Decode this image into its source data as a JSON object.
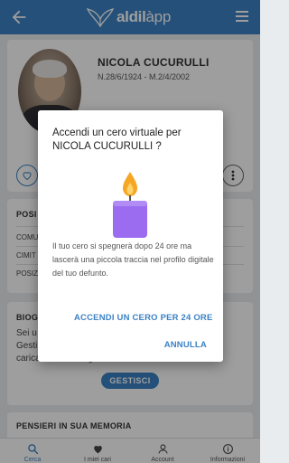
{
  "appbar": {
    "logo_main": "aldil",
    "logo_suffix": "àpp",
    "back_icon": "arrow-left-icon",
    "menu_icon": "hamburger-icon"
  },
  "profile": {
    "name": "NICOLA CUCURULLI",
    "dates": "N.28/6/1924 - M.2/4/2002"
  },
  "position_section": {
    "title": "POSI",
    "rows": [
      "COMU",
      "CIMIT",
      "POSIZ"
    ]
  },
  "bio_section": {
    "title": "BIOG",
    "text_lines": [
      "Sei u",
      "Gesti",
      "caricare foto e biografia."
    ],
    "manage_button": "GESTISCI"
  },
  "memory_section": {
    "title": "PENSIERI IN SUA MEMORIA"
  },
  "dialog": {
    "title": "Accendi un cero virtuale per NICOLA CUCURULLI ?",
    "body": "Il tuo cero si spegnerà dopo 24 ore ma lascerà una piccola traccia nel profilo digitale del tuo defunto.",
    "confirm": "ACCENDI UN CERO PER 24 ORE",
    "cancel": "ANNULLA"
  },
  "bottom_nav": [
    {
      "label": "Cerca",
      "icon": "search-icon"
    },
    {
      "label": "I miei cari",
      "icon": "heart-icon"
    },
    {
      "label": "Account",
      "icon": "user-icon"
    },
    {
      "label": "Informazioni",
      "icon": "info-icon"
    }
  ],
  "colors": {
    "primary": "#3b82c4",
    "candle_body": "#9b6cf0",
    "candle_flame": "#f5a623"
  }
}
